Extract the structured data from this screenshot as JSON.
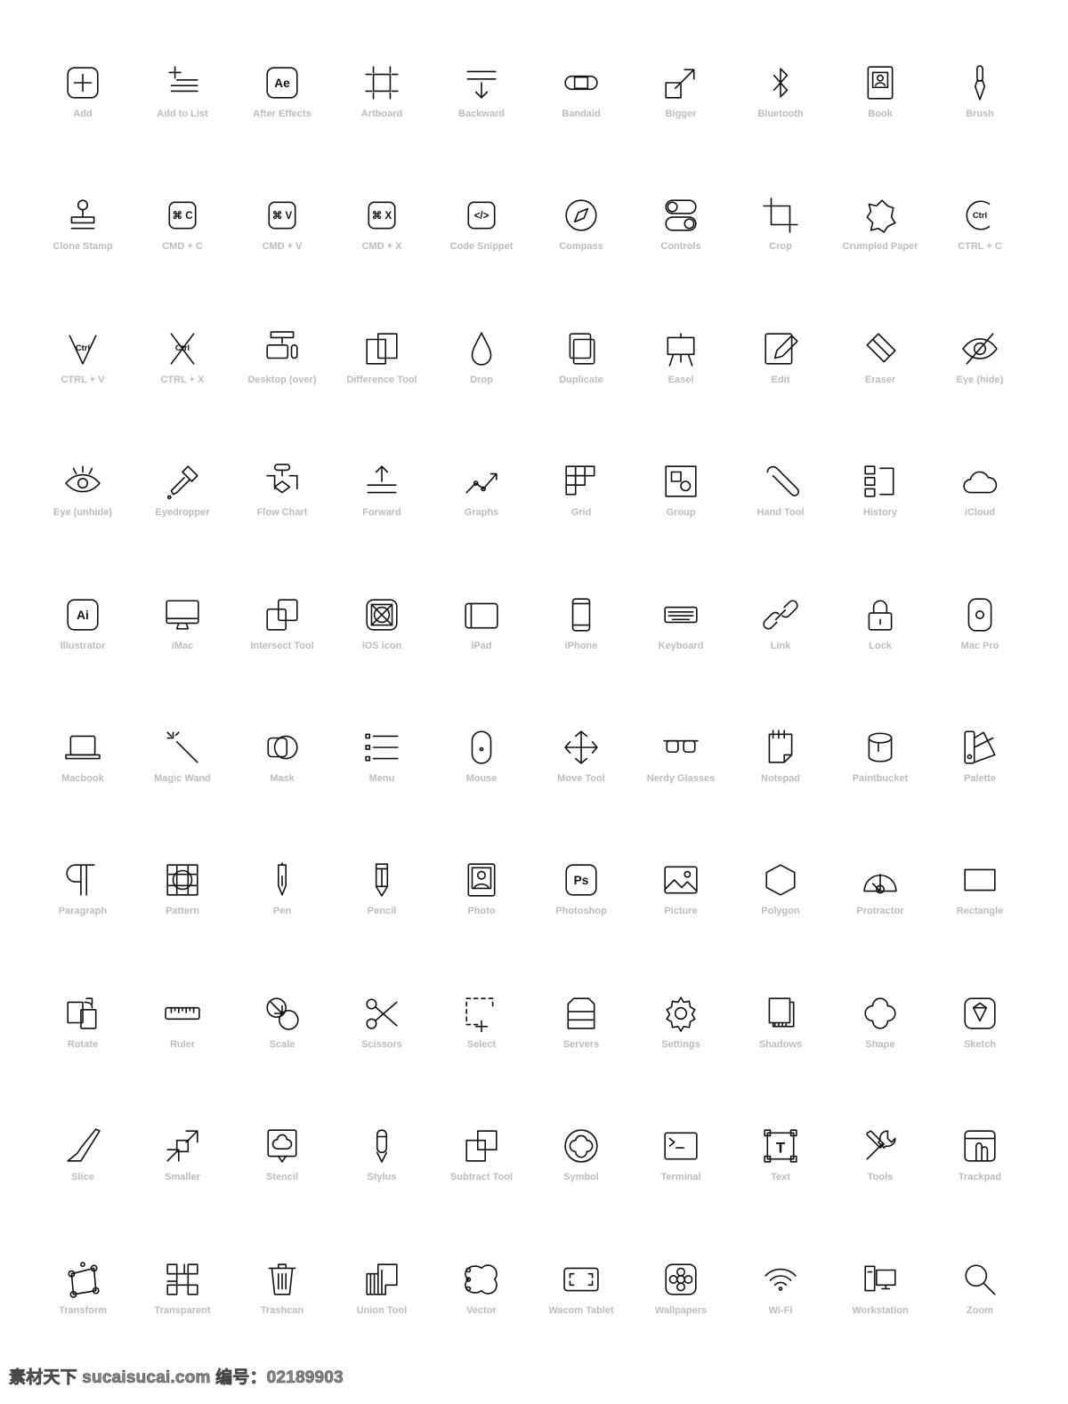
{
  "icons": [
    {
      "label": "Add",
      "icon": "add-icon"
    },
    {
      "label": "Add to List",
      "icon": "add-to-list-icon"
    },
    {
      "label": "After Effects",
      "icon": "after-effects-icon",
      "glyph": "Ae"
    },
    {
      "label": "Artboard",
      "icon": "artboard-icon"
    },
    {
      "label": "Backward",
      "icon": "backward-icon"
    },
    {
      "label": "Bandaid",
      "icon": "bandaid-icon"
    },
    {
      "label": "Bigger",
      "icon": "bigger-icon"
    },
    {
      "label": "Bluetooth",
      "icon": "bluetooth-icon"
    },
    {
      "label": "Book",
      "icon": "book-icon"
    },
    {
      "label": "Brush",
      "icon": "brush-icon"
    },
    {
      "label": "Clone Stamp",
      "icon": "clone-stamp-icon"
    },
    {
      "label": "CMD + C",
      "icon": "cmd-c-icon",
      "glyph": "⌘ C"
    },
    {
      "label": "CMD + V",
      "icon": "cmd-v-icon",
      "glyph": "⌘ V"
    },
    {
      "label": "CMD + X",
      "icon": "cmd-x-icon",
      "glyph": "⌘ X"
    },
    {
      "label": "Code Snippet",
      "icon": "code-snippet-icon",
      "glyph": "</>"
    },
    {
      "label": "Compass",
      "icon": "compass-icon"
    },
    {
      "label": "Controls",
      "icon": "controls-icon"
    },
    {
      "label": "Crop",
      "icon": "crop-icon"
    },
    {
      "label": "Crumpled Paper",
      "icon": "crumpled-paper-icon"
    },
    {
      "label": "CTRL + C",
      "icon": "ctrl-c-icon",
      "glyph": "Ctrl"
    },
    {
      "label": "CTRL + V",
      "icon": "ctrl-v-icon",
      "glyph": "Ctrl"
    },
    {
      "label": "CTRL + X",
      "icon": "ctrl-x-icon",
      "glyph": "Ctrl"
    },
    {
      "label": "Desktop (over)",
      "icon": "desktop-over-icon"
    },
    {
      "label": "Difference Tool",
      "icon": "difference-tool-icon"
    },
    {
      "label": "Drop",
      "icon": "drop-icon"
    },
    {
      "label": "Duplicate",
      "icon": "duplicate-icon"
    },
    {
      "label": "Easel",
      "icon": "easel-icon"
    },
    {
      "label": "Edit",
      "icon": "edit-icon"
    },
    {
      "label": "Eraser",
      "icon": "eraser-icon"
    },
    {
      "label": "Eye (hide)",
      "icon": "eye-hide-icon"
    },
    {
      "label": "Eye (unhide)",
      "icon": "eye-unhide-icon"
    },
    {
      "label": "Eyedropper",
      "icon": "eyedropper-icon"
    },
    {
      "label": "Flow Chart",
      "icon": "flow-chart-icon"
    },
    {
      "label": "Forward",
      "icon": "forward-icon"
    },
    {
      "label": "Graphs",
      "icon": "graphs-icon"
    },
    {
      "label": "Grid",
      "icon": "grid-icon"
    },
    {
      "label": "Group",
      "icon": "group-icon"
    },
    {
      "label": "Hand Tool",
      "icon": "hand-tool-icon"
    },
    {
      "label": "History",
      "icon": "history-icon"
    },
    {
      "label": "iCloud",
      "icon": "icloud-icon"
    },
    {
      "label": "Illustrator",
      "icon": "illustrator-icon",
      "glyph": "Ai"
    },
    {
      "label": "iMac",
      "icon": "imac-icon"
    },
    {
      "label": "Intersect Tool",
      "icon": "intersect-tool-icon"
    },
    {
      "label": "iOS Icon",
      "icon": "ios-icon-icon"
    },
    {
      "label": "iPad",
      "icon": "ipad-icon"
    },
    {
      "label": "iPhone",
      "icon": "iphone-icon"
    },
    {
      "label": "Keyboard",
      "icon": "keyboard-icon"
    },
    {
      "label": "Link",
      "icon": "link-icon"
    },
    {
      "label": "Lock",
      "icon": "lock-icon"
    },
    {
      "label": "Mac Pro",
      "icon": "mac-pro-icon"
    },
    {
      "label": "Macbook",
      "icon": "macbook-icon"
    },
    {
      "label": "Magic Wand",
      "icon": "magic-wand-icon"
    },
    {
      "label": "Mask",
      "icon": "mask-icon"
    },
    {
      "label": "Menu",
      "icon": "menu-icon"
    },
    {
      "label": "Mouse",
      "icon": "mouse-icon"
    },
    {
      "label": "Move Tool",
      "icon": "move-tool-icon"
    },
    {
      "label": "Nerdy Glasses",
      "icon": "nerdy-glasses-icon"
    },
    {
      "label": "Notepad",
      "icon": "notepad-icon"
    },
    {
      "label": "Paintbucket",
      "icon": "paintbucket-icon"
    },
    {
      "label": "Palette",
      "icon": "palette-icon"
    },
    {
      "label": "Paragraph",
      "icon": "paragraph-icon"
    },
    {
      "label": "Pattern",
      "icon": "pattern-icon"
    },
    {
      "label": "Pen",
      "icon": "pen-icon"
    },
    {
      "label": "Pencil",
      "icon": "pencil-icon"
    },
    {
      "label": "Photo",
      "icon": "photo-icon"
    },
    {
      "label": "Photoshop",
      "icon": "photoshop-icon",
      "glyph": "Ps"
    },
    {
      "label": "Picture",
      "icon": "picture-icon"
    },
    {
      "label": "Polygon",
      "icon": "polygon-icon"
    },
    {
      "label": "Protractor",
      "icon": "protractor-icon"
    },
    {
      "label": "Rectangle",
      "icon": "rectangle-icon"
    },
    {
      "label": "Rotate",
      "icon": "rotate-icon"
    },
    {
      "label": "Ruler",
      "icon": "ruler-icon"
    },
    {
      "label": "Scale",
      "icon": "scale-icon"
    },
    {
      "label": "Scissors",
      "icon": "scissors-icon"
    },
    {
      "label": "Select",
      "icon": "select-icon"
    },
    {
      "label": "Servers",
      "icon": "servers-icon"
    },
    {
      "label": "Settings",
      "icon": "settings-icon"
    },
    {
      "label": "Shadows",
      "icon": "shadows-icon"
    },
    {
      "label": "Shape",
      "icon": "shape-icon"
    },
    {
      "label": "Sketch",
      "icon": "sketch-icon"
    },
    {
      "label": "Slice",
      "icon": "slice-icon"
    },
    {
      "label": "Smaller",
      "icon": "smaller-icon"
    },
    {
      "label": "Stencil",
      "icon": "stencil-icon"
    },
    {
      "label": "Stylus",
      "icon": "stylus-icon"
    },
    {
      "label": "Subtract Tool",
      "icon": "subtract-tool-icon"
    },
    {
      "label": "Symbol",
      "icon": "symbol-icon"
    },
    {
      "label": "Terminal",
      "icon": "terminal-icon"
    },
    {
      "label": "Text",
      "icon": "text-icon",
      "glyph": "T"
    },
    {
      "label": "Tools",
      "icon": "tools-icon"
    },
    {
      "label": "Trackpad",
      "icon": "trackpad-icon"
    },
    {
      "label": "Transform",
      "icon": "transform-icon"
    },
    {
      "label": "Transparent",
      "icon": "transparent-icon"
    },
    {
      "label": "Trashcan",
      "icon": "trashcan-icon"
    },
    {
      "label": "Union Tool",
      "icon": "union-tool-icon"
    },
    {
      "label": "Vector",
      "icon": "vector-icon"
    },
    {
      "label": "Wacom Tablet",
      "icon": "wacom-tablet-icon"
    },
    {
      "label": "Wallpapers",
      "icon": "wallpapers-icon"
    },
    {
      "label": "Wi-Fi",
      "icon": "wi-fi-icon"
    },
    {
      "label": "Workstation",
      "icon": "workstation-icon"
    },
    {
      "label": "Zoom",
      "icon": "zoom-icon"
    }
  ],
  "watermark": "素材天下 sucaisucai.com  编号：02189903",
  "colors": {
    "icon": "#111111",
    "label": "#bcbcbc"
  }
}
